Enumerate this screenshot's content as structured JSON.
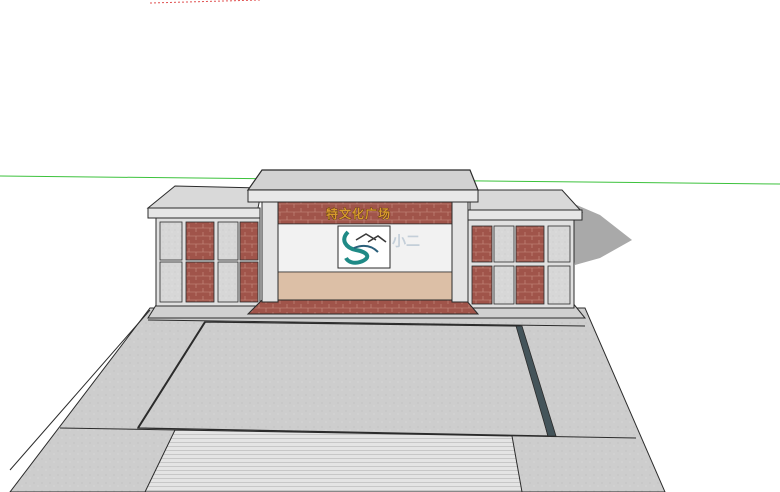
{
  "viewport": {
    "background": "#ffffff",
    "axes": {
      "green_axis_color": "#3cc23c",
      "red_axis_color": "#e05050"
    }
  },
  "model": {
    "gate_sign_text": "特文化广场",
    "poster_watermark_text": "小二"
  },
  "materials": {
    "brick": "#a0544a",
    "brick_mortar": "#c98f82",
    "stone_panel": "#d4d4d4",
    "roof": "#d9d9d9",
    "trim": "#e6e6e6",
    "floor": "#dcbfa6",
    "pavement": "#cfcfcf",
    "shadow": "#a9a9a9",
    "edge": "#2b2b2b"
  }
}
